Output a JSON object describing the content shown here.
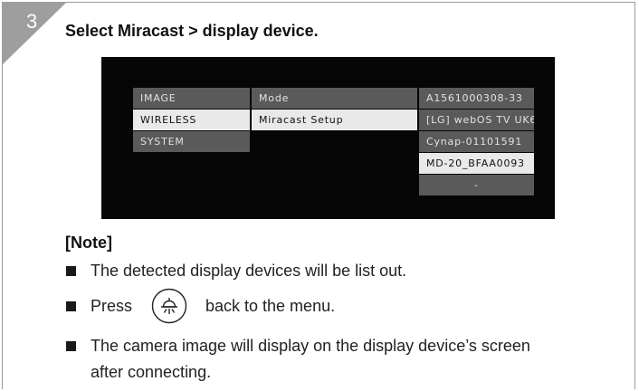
{
  "step": {
    "number": "3",
    "title": "Select Miracast > display device."
  },
  "osd": {
    "col1": [
      {
        "label": "IMAGE",
        "selected": false
      },
      {
        "label": "WIRELESS",
        "selected": true
      },
      {
        "label": "SYSTEM",
        "selected": false
      }
    ],
    "col2": [
      {
        "label": "Mode",
        "selected": false
      },
      {
        "label": "Miracast Setup",
        "selected": true
      }
    ],
    "col3": [
      {
        "label": "A1561000308-33",
        "selected": false
      },
      {
        "label": "[LG] webOS TV UK6...",
        "selected": false
      },
      {
        "label": "Cynap-01101591",
        "selected": false
      },
      {
        "label": "MD-20_BFAA0093",
        "selected": true
      },
      {
        "label": "-",
        "selected": false
      }
    ]
  },
  "note": {
    "heading": "[Note]",
    "bullet1": "The detected display devices will be list out.",
    "bullet2_before": "Press",
    "bullet2_after": "back to the menu.",
    "bullet2_icon": "light-button-icon",
    "bullet3_line1": "The camera image will display on the display device’s screen",
    "bullet3_line2": "after connecting."
  },
  "colors": {
    "corner_tab": "#9e9e9e",
    "osd_background": "#060606",
    "osd_item": "#5a5a5a",
    "osd_item_selected": "#e9e9e9",
    "frame_border": "#9a9a9a"
  }
}
